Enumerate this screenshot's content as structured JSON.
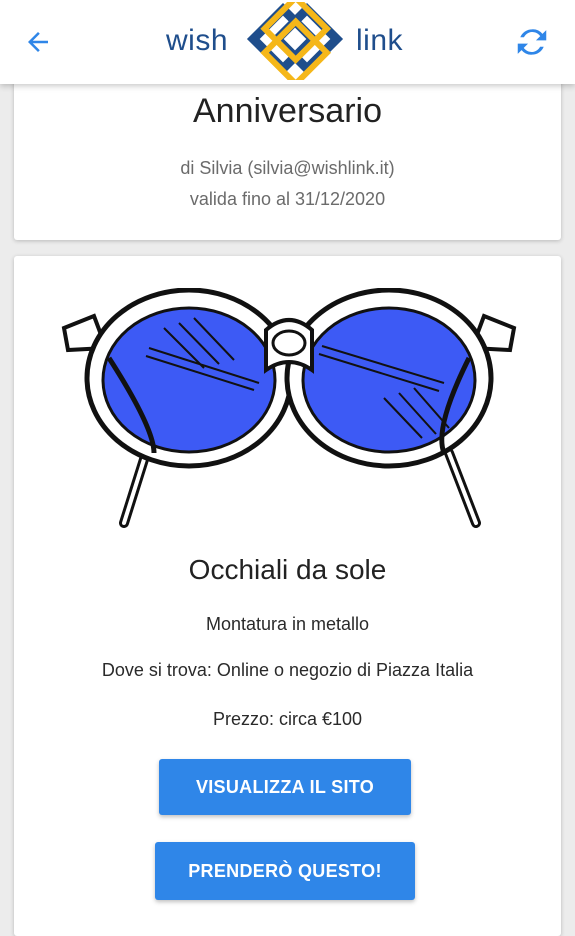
{
  "app": {
    "logo_left": "wish",
    "logo_right": "link",
    "accent_color": "#2f86e8",
    "brand_blue": "#1f4e8c",
    "brand_yellow": "#f5b719",
    "icons": {
      "back": "arrow-left-icon",
      "refresh": "refresh-icon"
    }
  },
  "list": {
    "title": "Anniversario",
    "owner": "di Silvia (silvia@wishlink.it)",
    "valid_until": "valida fino al 31/12/2020"
  },
  "item": {
    "image_icon": "sunglasses-image",
    "name": "Occhiali da sole",
    "description": "Montatura in metallo",
    "where": "Dove si trova: Online o negozio di Piazza Italia",
    "price": "Prezzo: circa €100"
  },
  "actions": {
    "view_site": "VISUALIZZA IL SITO",
    "take": "PRENDERÒ QUESTO!"
  }
}
